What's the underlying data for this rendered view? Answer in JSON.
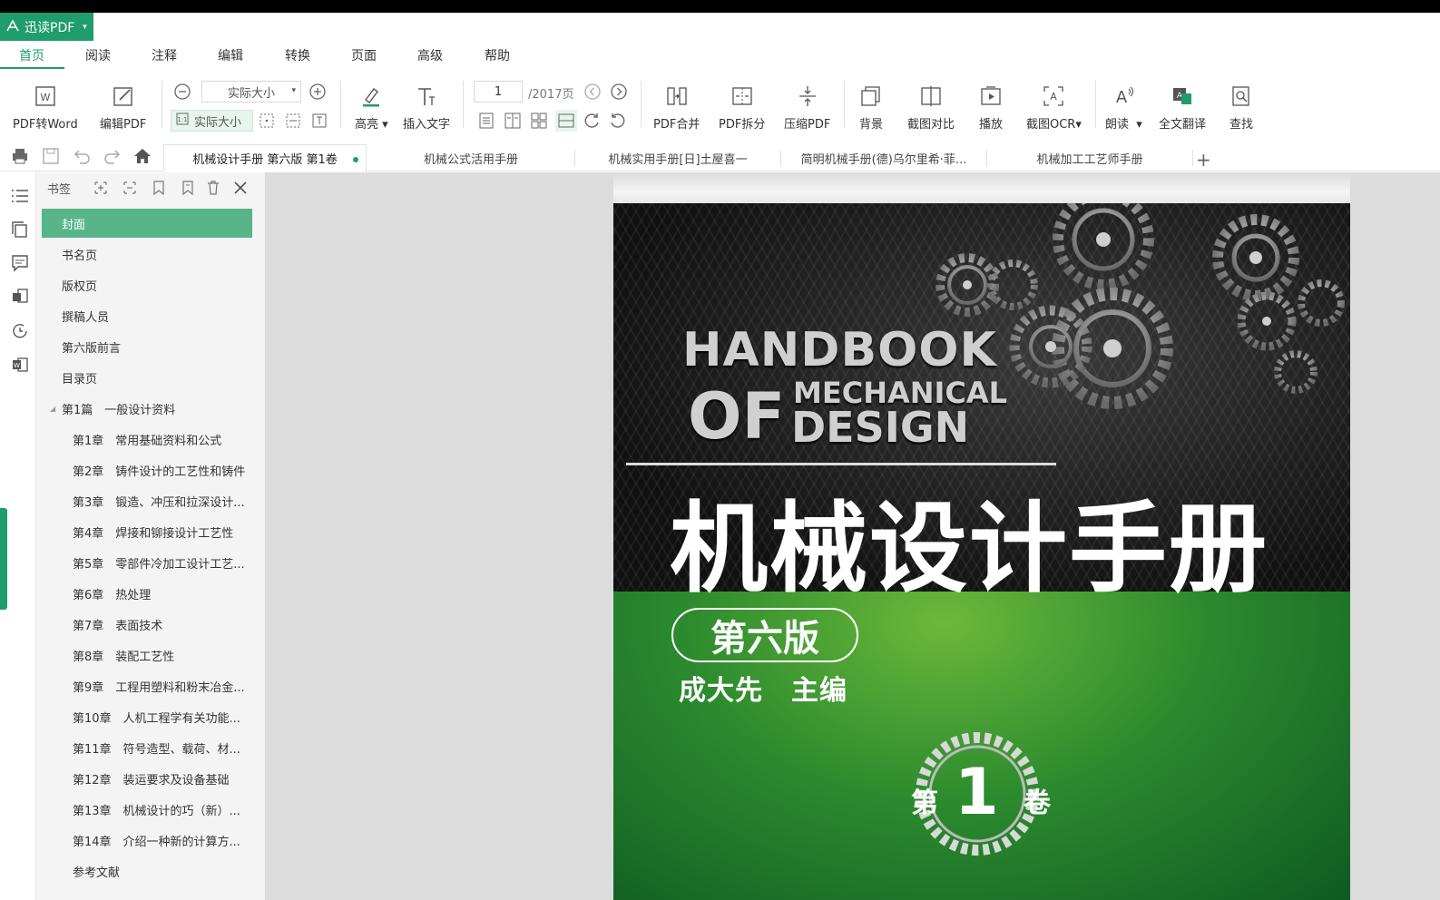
{
  "app": {
    "name": "迅读PDF",
    "accent": "#1f9d6c"
  },
  "menu": [
    "首页",
    "阅读",
    "注释",
    "编辑",
    "转换",
    "页面",
    "高级",
    "帮助"
  ],
  "ribbon": {
    "pdf_to_word": "PDF转Word",
    "edit_pdf": "编辑PDF",
    "zoom_value": "实际大小",
    "fit_actual": "实际大小",
    "highlight": "高亮",
    "insert_text": "插入文字",
    "page_current": "1",
    "page_total": "/2017页",
    "merge": "PDF合并",
    "split": "PDF拆分",
    "compress": "压缩PDF",
    "background": "背景",
    "compare": "截图对比",
    "play": "播放",
    "ocr": "截图OCR",
    "read_aloud": "朗读",
    "translate": "全文翻译",
    "find": "查找"
  },
  "tabs": [
    {
      "label": "机械设计手册 第六版 第1卷",
      "active": true
    },
    {
      "label": "机械公式活用手册",
      "active": false
    },
    {
      "label": "机械实用手册[日]土屋喜一",
      "active": false
    },
    {
      "label": "简明机械手册(德)乌尔里希·菲...",
      "active": false
    },
    {
      "label": "机械加工工艺师手册",
      "active": false
    }
  ],
  "bookmarks": {
    "title": "书签",
    "items": [
      {
        "label": "封面",
        "level": 0,
        "active": true
      },
      {
        "label": "书名页",
        "level": 0
      },
      {
        "label": "版权页",
        "level": 0
      },
      {
        "label": "撰稿人员",
        "level": 0
      },
      {
        "label": "第六版前言",
        "level": 0
      },
      {
        "label": "目录页",
        "level": 0
      },
      {
        "label": "第1篇　一般设计资料",
        "level": 0,
        "expanded": true
      },
      {
        "label": "第1章　常用基础资料和公式",
        "level": 1
      },
      {
        "label": "第2章　铸件设计的工艺性和铸件",
        "level": 1
      },
      {
        "label": "第3章　锻造、冲压和拉深设计...",
        "level": 1
      },
      {
        "label": "第4章　焊接和铆接设计工艺性",
        "level": 1
      },
      {
        "label": "第5章　零部件冷加工设计工艺...",
        "level": 1
      },
      {
        "label": "第6章　热处理",
        "level": 1
      },
      {
        "label": "第7章　表面技术",
        "level": 1
      },
      {
        "label": "第8章　装配工艺性",
        "level": 1
      },
      {
        "label": "第9章　工程用塑料和粉末冶金...",
        "level": 1
      },
      {
        "label": "第10章　人机工程学有关功能...",
        "level": 1
      },
      {
        "label": "第11章　符号造型、载荷、材...",
        "level": 1
      },
      {
        "label": "第12章　装运要求及设备基础",
        "level": 1
      },
      {
        "label": "第13章　机械设计的巧（新）...",
        "level": 1
      },
      {
        "label": "第14章　介绍一种新的计算方...",
        "level": 1
      },
      {
        "label": "参考文献",
        "level": 1
      }
    ]
  },
  "cover": {
    "en_line1": "HANDBOOK",
    "en_of": "OF",
    "en_mechanical": "MECHANICAL",
    "en_design": "DESIGN",
    "cn_title": "机械设计手册",
    "edition": "第六版",
    "editor": "成大先　主编",
    "vol_prefix": "第",
    "vol_number": "1",
    "vol_suffix": "卷"
  }
}
